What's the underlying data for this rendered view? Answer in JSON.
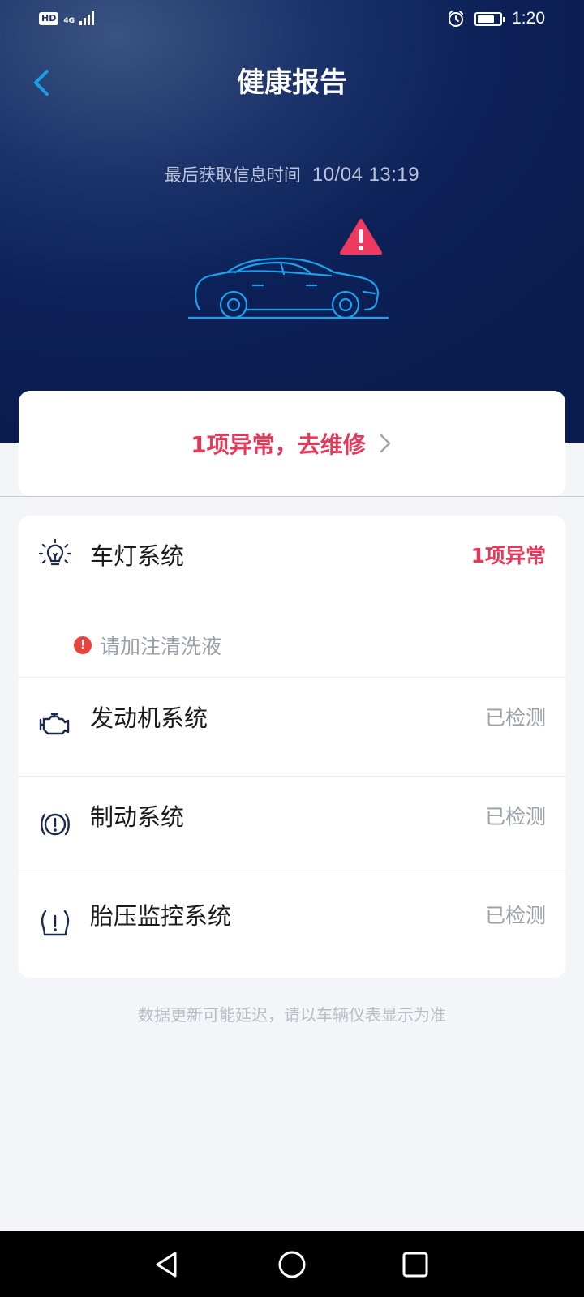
{
  "status_bar": {
    "hd_label": "HD",
    "network_label": "4G",
    "time": "1:20",
    "battery_level": 0.75,
    "icons": [
      "signal-icon",
      "alarm-icon",
      "battery-icon"
    ]
  },
  "header": {
    "title": "健康报告",
    "back_icon": "chevron-left-icon"
  },
  "report": {
    "last_fetch_label": "最后获取信息时间",
    "last_fetch_time": "10/04 13:19",
    "alert_icon": "warning-triangle-icon"
  },
  "repair": {
    "label": "1项异常，去维修",
    "chevron_icon": "chevron-right-icon"
  },
  "systems": [
    {
      "label": "车灯系统",
      "status": "1项异常",
      "icon": "light-bulb-icon",
      "issues": [
        "请加注清洗液"
      ]
    },
    {
      "label": "发动机系统",
      "status": "已检测",
      "icon": "engine-icon"
    },
    {
      "label": "制动系统",
      "status": "已检测",
      "icon": "brake-icon"
    },
    {
      "label": "胎压监控系统",
      "status": "已检测",
      "icon": "tire-pressure-icon"
    }
  ],
  "footnote": "数据更新可能延迟，请以车辆仪表显示为准",
  "colors": {
    "accent_blue": "#1aa0e8",
    "alert_red": "#e23a5b",
    "header_dark": "#0c2158"
  },
  "nav": {
    "icons": [
      "back-triangle-icon",
      "home-circle-icon",
      "recents-square-icon"
    ]
  }
}
